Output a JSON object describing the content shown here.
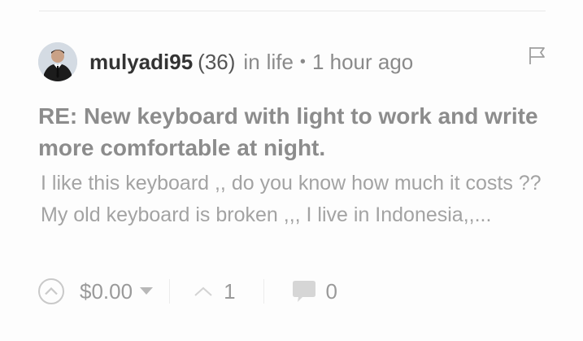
{
  "post": {
    "author": "mulyadi95",
    "reputation": "(36)",
    "in_label": "in",
    "category": "life",
    "separator": "•",
    "time": "1 hour ago",
    "title": "RE: New keyboard with light to work and write more comfortable at night.",
    "excerpt": "I like this keyboard ,, do you know how much it costs ?? My old keyboard is broken ,,, I live in Indonesia,,..."
  },
  "footer": {
    "payout": "$0.00",
    "votes": "1",
    "comments": "0"
  },
  "icons": {
    "flag": "flag-icon",
    "upvote": "chevron-up-circle-icon",
    "dropdown": "caret-down-icon",
    "votes": "chevron-up-icon",
    "comments": "speech-bubble-icon"
  },
  "colors": {
    "author": "#333333",
    "meta": "#8a8a8a",
    "title": "#8c8c8c",
    "excerpt": "#a3a3a3",
    "icons": "#c9c9c9"
  }
}
